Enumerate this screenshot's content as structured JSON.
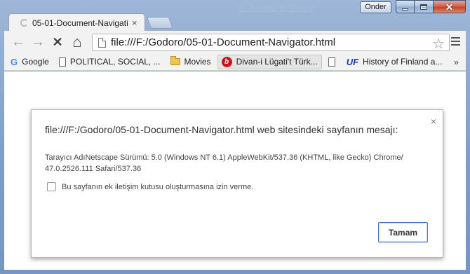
{
  "window": {
    "background_title": "K. Javascript Tinsey",
    "user_button": "Onder"
  },
  "tab": {
    "title": "05-01-Document-Navigati",
    "close_glyph": "×"
  },
  "toolbar": {
    "back_glyph": "←",
    "forward_glyph": "→",
    "stop_glyph": "✕",
    "home_glyph": "⌂",
    "url": "file:///F:/Godoro/05-01-Document-Navigator.html",
    "star_glyph": "☆"
  },
  "bookmarks": [
    {
      "label": "Google",
      "icon": "google-icon"
    },
    {
      "label": "POLITICAL, SOCIAL, ...",
      "icon": "page-icon"
    },
    {
      "label": "Movies",
      "icon": "folder-icon"
    },
    {
      "label": "Divan-i Lügati't Türk...",
      "icon": "bookmark-b-icon"
    },
    {
      "label": "",
      "icon": "page-icon"
    },
    {
      "label": "History of Finland a...",
      "icon": "uf-icon"
    }
  ],
  "bookmarks_overflow": "»",
  "dialog": {
    "title": "file:///F:/Godoro/05-01-Document-Navigator.html web sitesindeki sayfanın mesajı:",
    "message": "Tarayıcı AdıNetscape Sürümü: 5.0 (Windows NT 6.1) AppleWebKit/537.36 (KHTML, like Gecko) Chrome/ 47.0.2526.111 Safari/537.36",
    "checkbox_label": "Bu sayfanın ek iletişim kutusu oluşturmasına izin verme.",
    "ok_label": "Tamam",
    "close_glyph": "×"
  }
}
